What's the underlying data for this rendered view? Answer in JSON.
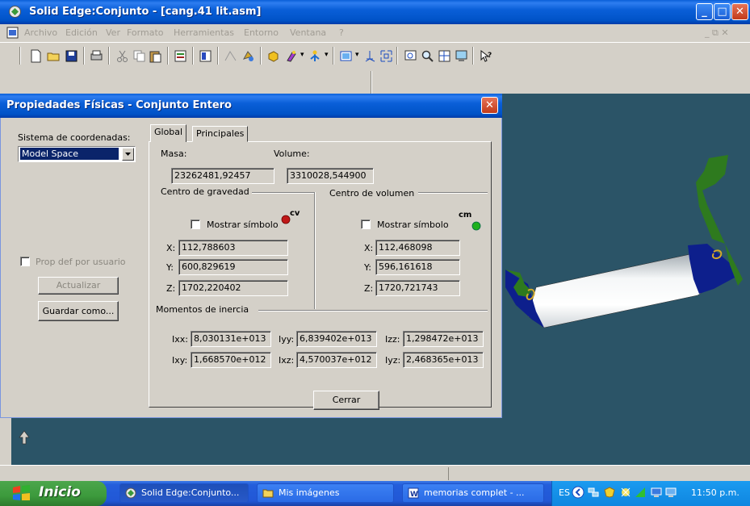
{
  "window": {
    "title": "Solid Edge:Conjunto - [cang.41 lit.asm]",
    "min_glyph": "_",
    "max_glyph": "□",
    "close_glyph": "✕"
  },
  "menu": [
    "Archivo",
    "Edición",
    "Ver",
    "Formato",
    "Herramientas",
    "Entorno",
    "Ventana",
    "?"
  ],
  "menu_right": "_ ⧉ ✕",
  "dialog": {
    "title": "Propiedades Físicas - Conjunto Entero",
    "close_glyph": "✕",
    "coord_label": "Sistema de coordenadas:",
    "coord_value": "Model Space",
    "prop_user_label": "Prop def por usuario",
    "update_button": "Actualizar",
    "save_as_button": "Guardar como...",
    "tabs": [
      "Global",
      "Principales"
    ],
    "mass_label": "Masa:",
    "mass_value": "23262481,92457",
    "volume_label": "Volume:",
    "volume_value": "3310028,544900",
    "cog_group": "Centro de gravedad",
    "cov_group": "Centro de volumen",
    "show_symbol": "Mostrar símbolo",
    "cog_symbol": "cv",
    "cov_symbol": "cm",
    "cog": {
      "x_label": "X:",
      "x": "112,788603",
      "y_label": "Y:",
      "y": "600,829619",
      "z_label": "Z:",
      "z": "1702,220402"
    },
    "cov": {
      "x_label": "X:",
      "x": "112,468098",
      "y_label": "Y:",
      "y": "596,161618",
      "z_label": "Z:",
      "z": "1720,721743"
    },
    "inertia_group": "Momentos de inercia",
    "inertia": {
      "ixx_label": "Ixx:",
      "ixx": "8,030131e+013",
      "iyy_label": "Iyy:",
      "iyy": "6,839402e+013",
      "izz_label": "Izz:",
      "izz": "1,298472e+013",
      "ixy_label": "Ixy:",
      "ixy": "1,668570e+012",
      "ixz_label": "Ixz:",
      "ixz": "4,570037e+012",
      "iyz_label": "Iyz:",
      "iyz": "2,468365e+013"
    },
    "close_button": "Cerrar"
  },
  "taskbar": {
    "start": "Inicio",
    "tasks": [
      "Solid Edge:Conjunto...",
      "Mis imágenes",
      "memorias complet - ..."
    ],
    "lang": "ES",
    "clock": "11:50 p.m."
  },
  "colors": {
    "viewport": "#2b5467",
    "titlebar": "#0a5fd8",
    "model_blue": "#0d1f8c",
    "model_green": "#2e7a1e"
  }
}
